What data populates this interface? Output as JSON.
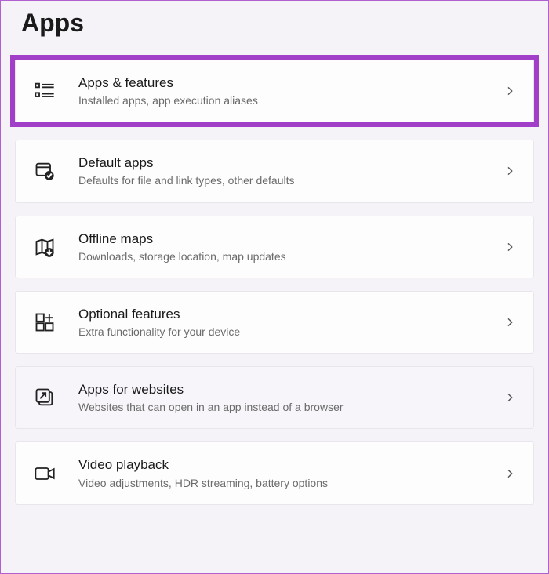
{
  "page_title": "Apps",
  "items": [
    {
      "title": "Apps & features",
      "subtitle": "Installed apps, app execution aliases",
      "highlighted": true
    },
    {
      "title": "Default apps",
      "subtitle": "Defaults for file and link types, other defaults"
    },
    {
      "title": "Offline maps",
      "subtitle": "Downloads, storage location, map updates"
    },
    {
      "title": "Optional features",
      "subtitle": "Extra functionality for your device"
    },
    {
      "title": "Apps for websites",
      "subtitle": "Websites that can open in an app instead of a browser",
      "muted": true
    },
    {
      "title": "Video playback",
      "subtitle": "Video adjustments, HDR streaming, battery options"
    }
  ]
}
